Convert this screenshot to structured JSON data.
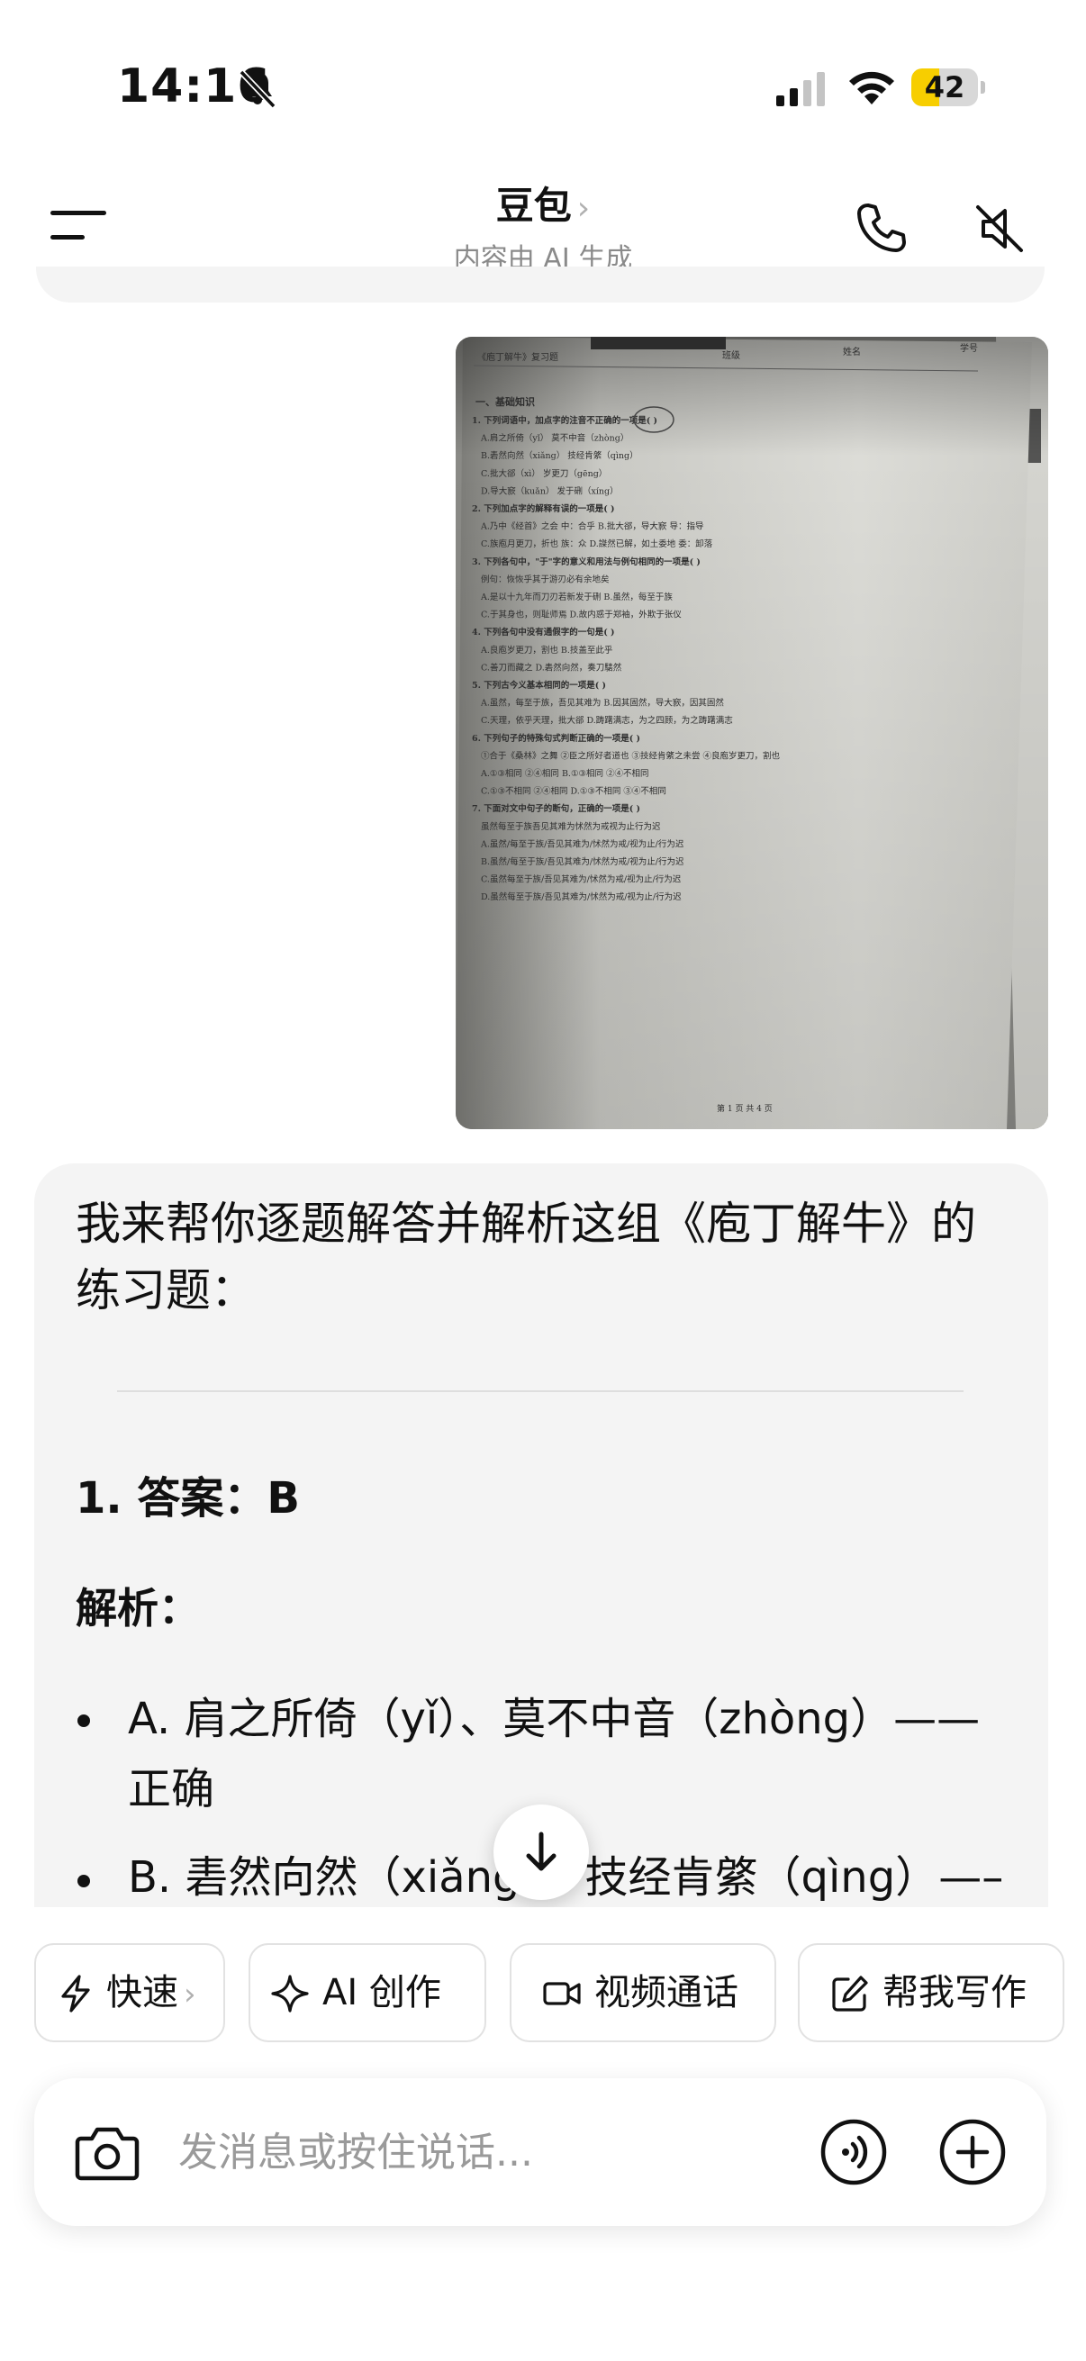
{
  "status": {
    "time": "14:16",
    "battery": "42",
    "battery_level": 0.42
  },
  "header": {
    "title": "豆包",
    "chevron": "›",
    "subtitle": "内容由 AI 生成"
  },
  "answer": {
    "intro": "我来帮你逐题解答并解析这组《庖丁解牛》的练习题：",
    "question_title": "1. 答案：B",
    "analysis_label": "解析：",
    "bullets": [
      "A. 肩之所倚（yǐ）、莫不中音（zhòng）——正确",
      "B. 砉然向然（xiǎng）、技经肯綮（qìng）——"
    ]
  },
  "quick_actions": [
    {
      "label": "快速",
      "icon": "lightning-icon",
      "chevron": "›"
    },
    {
      "label": "AI 创作",
      "icon": "sparkle-icon"
    },
    {
      "label": "视频通话",
      "icon": "video-camera-icon"
    },
    {
      "label": "帮我写作",
      "icon": "edit-icon"
    }
  ],
  "input": {
    "placeholder": "发消息或按住说话..."
  },
  "worksheet": {
    "header": "《庖丁解牛》复习题",
    "class_label": "班级",
    "name_label": "姓名",
    "id_label": "学号",
    "section": "一、基础知识",
    "lines": [
      "1. 下列词语中，加点字的注音不正确的一项是(   )",
      "A.肩之所倚（yǐ）         莫不中音（zhòng）",
      "B.砉然向然（xiǎng）      技经肯綮（qìng）",
      "C.批大郤（xì）           岁更刀（gēng）",
      "D.导大窾（kuǎn）         发于硎（xíng）",
      "2. 下列加点字的解释有误的一项是(   )",
      "A.乃中《经首》之会  中：合乎     B.批大郤，导大窾     导：指导",
      "C.族庖月更刀，折也  族：众       D.謋然已解，如土委地 委：卸落",
      "3. 下列各句中，\"于\"字的意义和用法与例句相同的一项是(   )",
      "例句：恢恢乎其于游刃必有余地矣",
      "A.是以十九年而刀刃若新发于硎     B.虽然，每至于族",
      "C.于其身也，则耻师焉             D.故内惑于郑袖，外欺于张仪",
      "4. 下列各句中没有通假字的一句是(   )",
      "A.良庖岁更刀，割也               B.技盖至此乎",
      "C.善刀而藏之                     D.砉然向然，奏刀騞然",
      "5. 下列古今义基本相同的一项是(   )",
      "A.虽然，每至于族，吾见其难为     B.因其固然，导大窾，因其固然",
      "C.天理，依乎天理，批大郤         D.踌躇满志，为之四顾，为之踌躇满志",
      "6. 下列句子的特殊句式判断正确的一项是(   )",
      "①合于《桑林》之舞  ②臣之所好者道也  ③技经肯綮之未尝  ④良庖岁更刀，割也",
      "A.①③相同  ②④相同               B.①③相同  ②④不相同",
      "C.①③不相同  ②④相同             D.①③不相同  ③④不相同",
      "7. 下面对文中句子的断句，正确的一项是(   )",
      "虽然每至于族吾见其难为怵然为戒视为止行为迟",
      "A.虽然/每至于族/吾见其难为/怵然为戒/视为止/行为迟",
      "B.虽然/每至于族/吾见其难为/怵然为戒/视为止/行为迟",
      "C.虽然每至于族/吾见其难为/怵然为戒/视为止/行为迟",
      "D.虽然每至于族/吾见其难为/怵然为戒/视为止/行为迟"
    ],
    "page": "第 1 页 共 4 页"
  }
}
